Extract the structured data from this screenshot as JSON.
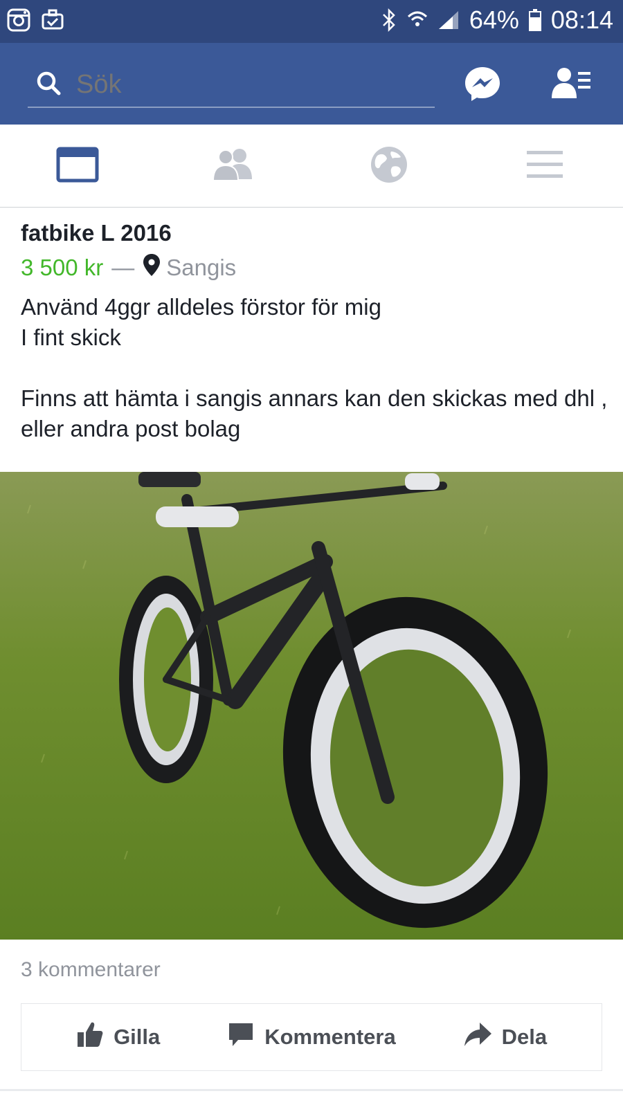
{
  "status_bar": {
    "battery": "64%",
    "time": "08:14",
    "icons": [
      "instagram-icon",
      "briefcase-icon",
      "bluetooth-icon",
      "wifi-icon",
      "signal-icon",
      "battery-icon"
    ]
  },
  "header": {
    "search_placeholder": "Sök",
    "icons": [
      "search-icon",
      "messenger-icon",
      "friend-requests-icon"
    ],
    "accent_color": "#3b5998"
  },
  "tabs": [
    {
      "name": "news-feed",
      "icon": "news-feed-icon",
      "active": true
    },
    {
      "name": "friends",
      "icon": "friends-icon",
      "active": false
    },
    {
      "name": "notifications",
      "icon": "globe-icon",
      "active": false
    },
    {
      "name": "menu",
      "icon": "menu-icon",
      "active": false
    }
  ],
  "post": {
    "title": "fatbike L 2016",
    "price": "3 500 kr",
    "separator": "—",
    "location": "Sangis",
    "description_lines": [
      "Använd 4ggr alldeles förstor för mig",
      "I fint skick",
      "",
      "Finns att hämta i sangis annars kan den skickas med dhl , eller andra post bolag"
    ],
    "price_color": "#42b72a"
  },
  "footer": {
    "comments": "3 kommentarer",
    "like_label": "Gilla",
    "comment_label": "Kommentera",
    "share_label": "Dela"
  }
}
